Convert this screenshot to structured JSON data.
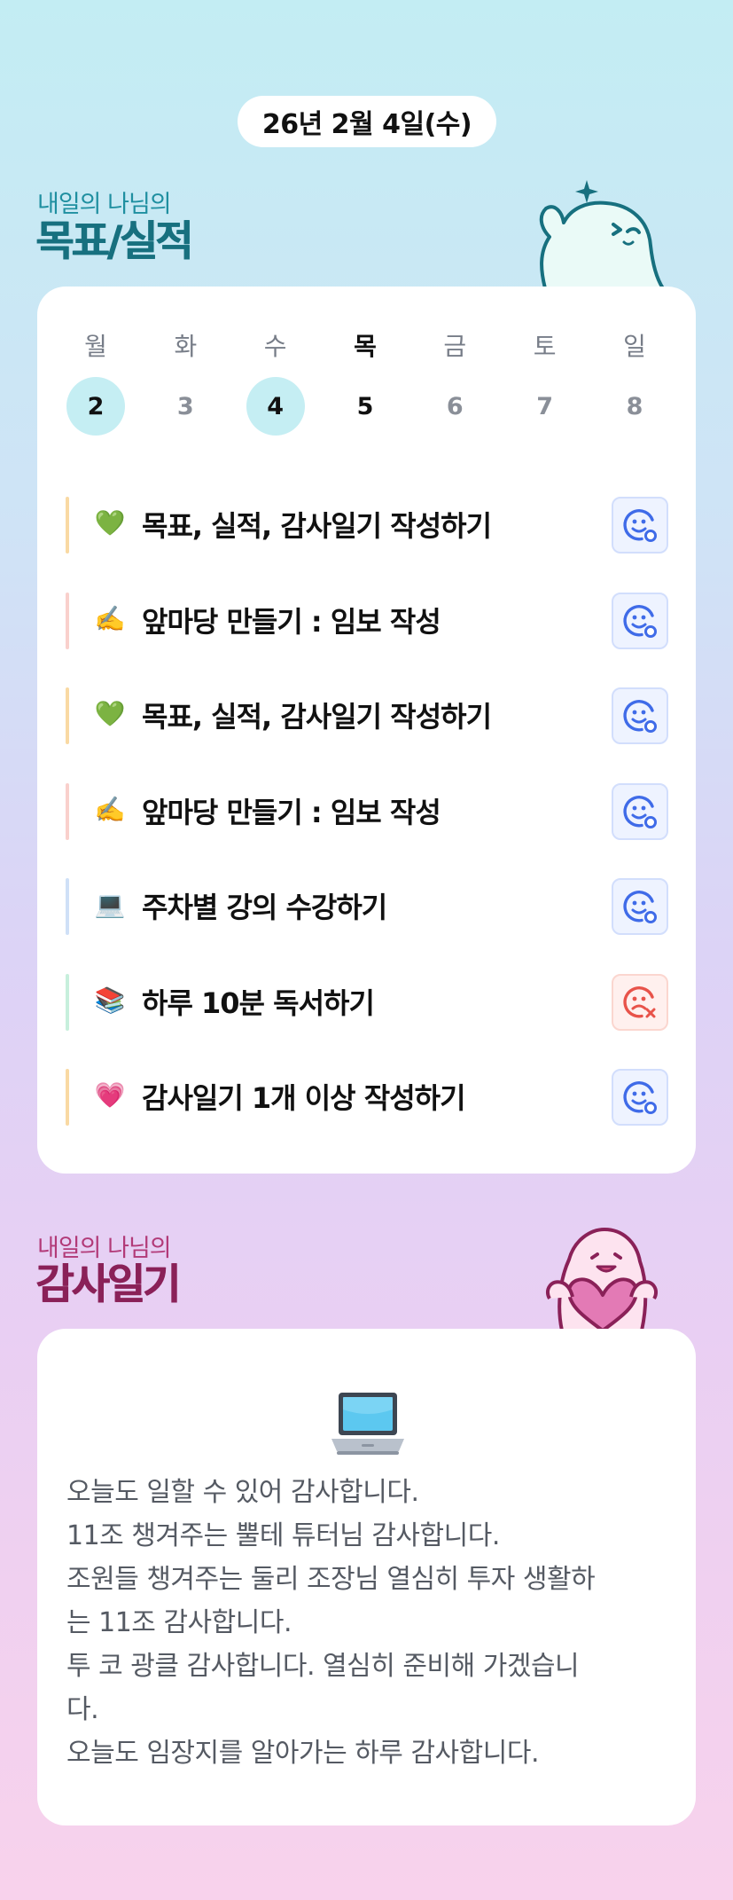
{
  "date_label": "26년 2월 4일(수)",
  "goals_section": {
    "subtitle": "내일의 나님의",
    "title": "목표/실적",
    "accent_color": "#17707f"
  },
  "week": {
    "days": [
      {
        "name": "월",
        "num": "2",
        "marked": true
      },
      {
        "name": "화",
        "num": "3",
        "marked": false
      },
      {
        "name": "수",
        "num": "4",
        "marked": true
      },
      {
        "name": "목",
        "num": "5",
        "marked": false,
        "today": true
      },
      {
        "name": "금",
        "num": "6",
        "marked": false
      },
      {
        "name": "토",
        "num": "7",
        "marked": false
      },
      {
        "name": "일",
        "num": "8",
        "marked": false
      }
    ]
  },
  "goals": [
    {
      "emoji": "💚",
      "text": "목표, 실적, 감사일기 작성하기",
      "bar_color": "#f9d9a3",
      "status": "done",
      "status_icon": "smile-icon"
    },
    {
      "emoji": "✍️",
      "text": "앞마당 만들기 : 임보 작성",
      "bar_color": "#f9d0cc",
      "status": "done",
      "status_icon": "smile-icon"
    },
    {
      "emoji": "💚",
      "text": "목표, 실적, 감사일기 작성하기",
      "bar_color": "#f9d9a3",
      "status": "done",
      "status_icon": "smile-icon"
    },
    {
      "emoji": "✍️",
      "text": "앞마당 만들기 : 임보 작성",
      "bar_color": "#f9d0cc",
      "status": "done",
      "status_icon": "smile-icon"
    },
    {
      "emoji": "💻",
      "text": "주차별 강의 수강하기",
      "bar_color": "#cfe0f7",
      "status": "done",
      "status_icon": "smile-icon"
    },
    {
      "emoji": "📚",
      "text": "하루 10분 독서하기",
      "bar_color": "#c7efdc",
      "status": "failed",
      "status_icon": "sad-icon"
    },
    {
      "emoji": "💗",
      "text": "감사일기 1개 이상 작성하기",
      "bar_color": "#f9d9a3",
      "status": "done",
      "status_icon": "smile-icon"
    }
  ],
  "gratitude_section": {
    "subtitle": "내일의 나님의",
    "title": "감사일기",
    "accent_color": "#8a2158",
    "icon": "laptop-icon",
    "lines": [
      "오늘도 일할 수 있어 감사합니다.",
      "11조 챙겨주는 뿔테 튜터님 감사합니다.",
      "조원들 챙겨주는 둘리 조장님 열심히 투자 생활하",
      "는 11조 감사합니다.",
      "투 코 광클 감사합니다. 열심히 준비해 가겠습니",
      "다.",
      "오늘도 임장지를 알아가는 하루 감사합니다."
    ]
  },
  "colors": {
    "smile_blue": "#3f6be8",
    "sad_red": "#e8534a",
    "marked_day": "#c5eef3"
  }
}
